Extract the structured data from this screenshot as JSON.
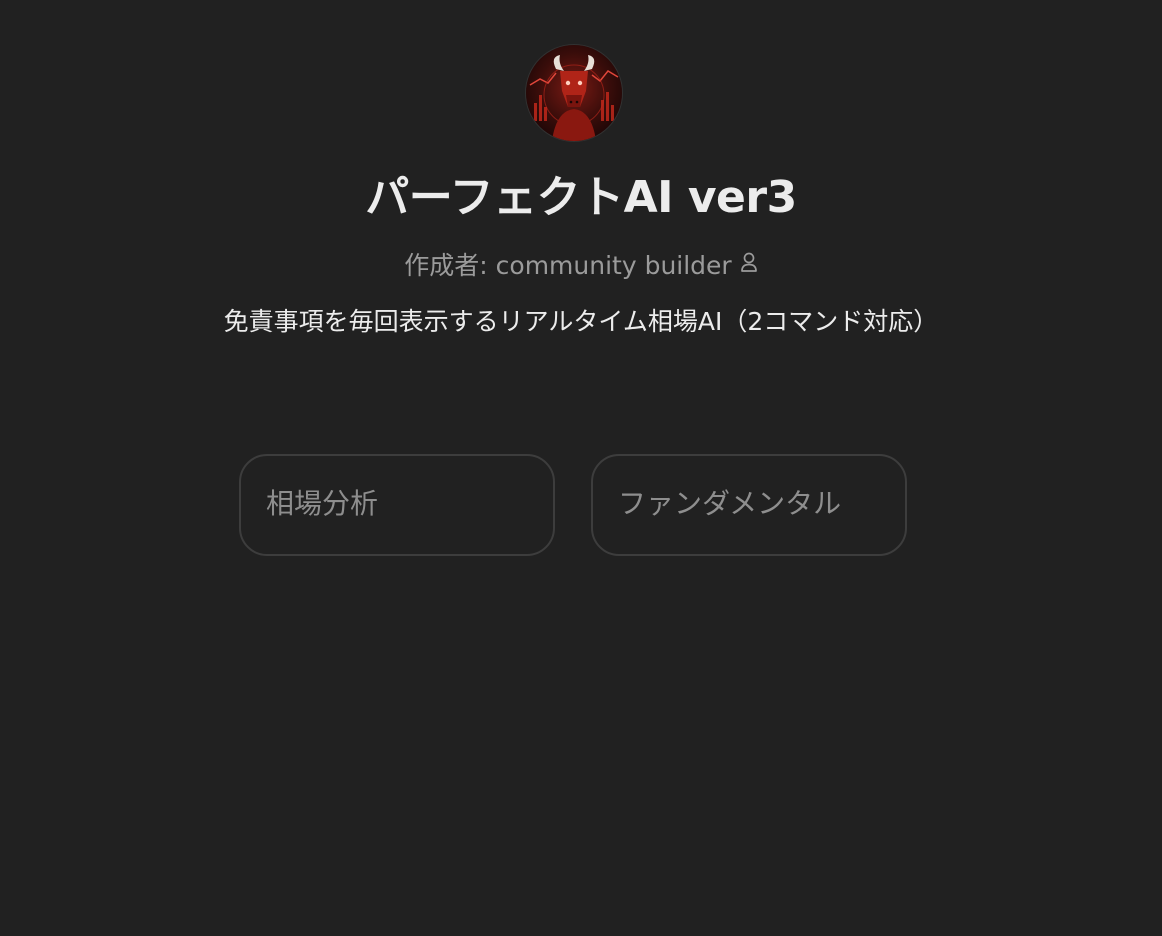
{
  "gpt": {
    "avatar_icon": "bull-logo-icon",
    "title": "パーフェクトAI ver3",
    "author": "作成者: community builder",
    "author_icon": "person-icon",
    "description": "免責事項を毎回表示するリアルタイム相場AI（2コマンド対応）"
  },
  "starters": [
    {
      "label": "相場分析"
    },
    {
      "label": "ファンダメンタル"
    }
  ],
  "colors": {
    "background": "#212121",
    "title_text": "#ececec",
    "muted_text": "#9b9b9b",
    "starter_border": "#3d3d3d",
    "starter_text": "#8e8e8e",
    "avatar_accent": "#c0281c"
  }
}
